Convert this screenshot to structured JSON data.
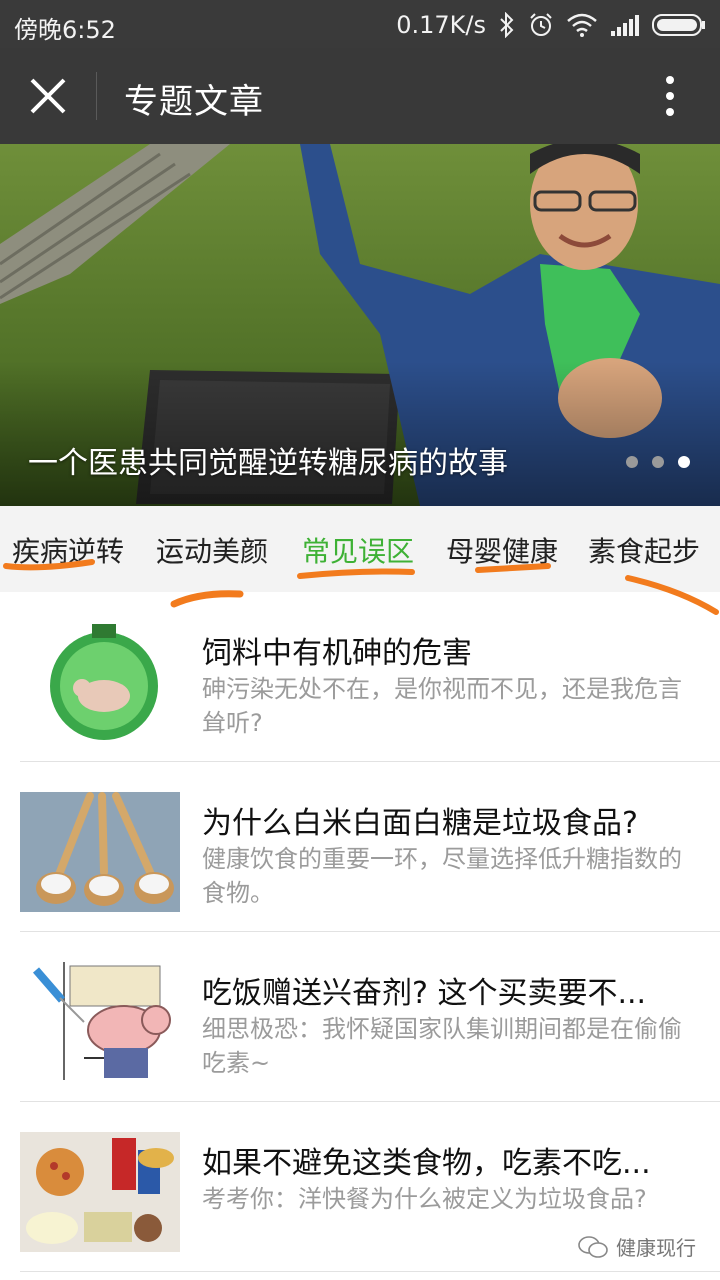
{
  "status_bar": {
    "time": "傍晚6:52",
    "speed": "0.17K/s"
  },
  "nav": {
    "title": "专题文章"
  },
  "banner": {
    "caption": "一个医患共同觉醒逆转糖尿病的故事"
  },
  "tabs": [
    {
      "label": "疾病逆转"
    },
    {
      "label": "运动美颜"
    },
    {
      "label": "常见误区"
    },
    {
      "label": "母婴健康"
    },
    {
      "label": "素食起步"
    }
  ],
  "colors": {
    "active_tab": "#3eb135",
    "annotation": "#f27b1d"
  },
  "articles": [
    {
      "title": "饲料中有机砷的危害",
      "desc": "砷污染无处不在，是你视而不见，还是我危言耸听?",
      "thumb_icon": "pig-in-bottle-icon"
    },
    {
      "title": "为什么白米白面白糖是垃圾食品?",
      "desc": "健康饮食的重要一环，尽量选择低升糖指数的食物。",
      "thumb_icon": "sugar-spoons-icon"
    },
    {
      "title": "吃饭赠送兴奋剂? 这个买卖要不...",
      "desc": "细思极恐：我怀疑国家队集训期间都是在偷偷吃素~",
      "thumb_icon": "pig-injection-icon"
    },
    {
      "title": "如果不避免这类食物，吃素不吃...",
      "desc": "考考你：洋快餐为什么被定义为垃圾食品?",
      "thumb_icon": "junk-food-icon"
    }
  ],
  "watermark": {
    "text": "健康现行"
  }
}
